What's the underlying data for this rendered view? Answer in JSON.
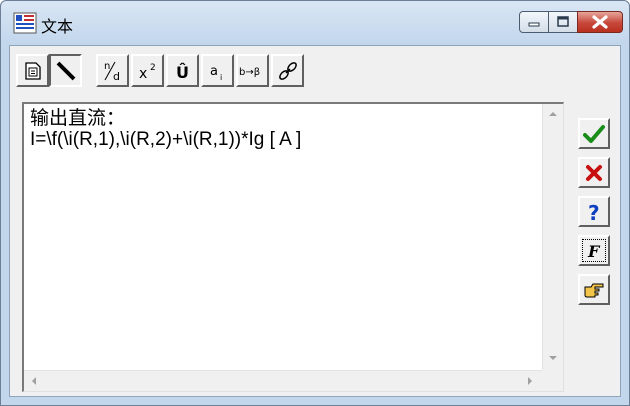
{
  "window": {
    "title": "文本",
    "icons": {
      "app": "text-app-icon",
      "minimize": "minimize-icon",
      "maximize": "maximize-icon",
      "close": "close-icon"
    }
  },
  "toolbar": {
    "fraction_glyph_top": "n",
    "fraction_glyph_bottom": "d",
    "superscript_base": "x",
    "superscript_exp": "2",
    "hat_glyph": "Û",
    "subscript_base": "a",
    "subscript_index": "i",
    "greek_label": "b→β",
    "icons": [
      "document-icon",
      "pen-icon",
      "fraction-icon",
      "superscript-icon",
      "accent-icon",
      "subscript-icon",
      "greek-convert-icon",
      "link-icon"
    ]
  },
  "editor": {
    "lines": [
      "输出直流：",
      "I=\\f(\\i(R,1),\\i(R,2)+\\i(R,1))*Ig [ A ]"
    ]
  },
  "side_buttons": [
    "ok-check-icon",
    "cancel-x-icon",
    "help-question-icon",
    "font-f-icon",
    "pointing-hand-icon"
  ],
  "font_button_label": "F",
  "colors": {
    "ok": "#1a8c1a",
    "cancel": "#c81010",
    "help": "#1040c0",
    "titlebar": "#c8dbef"
  }
}
